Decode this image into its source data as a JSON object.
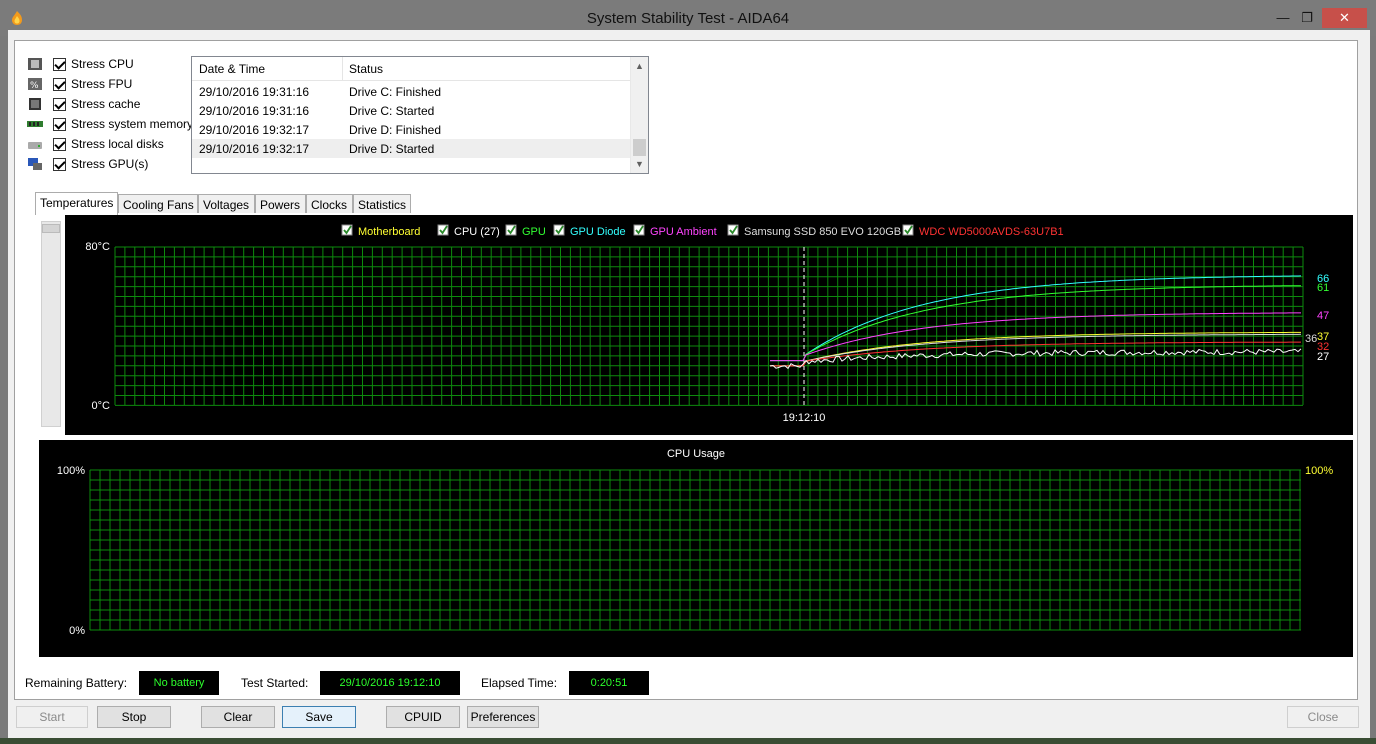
{
  "window": {
    "title": "System Stability Test - AIDA64",
    "minimize": "—",
    "restore": "❐",
    "close": "✕"
  },
  "stress": [
    {
      "icon": "cpu-icon",
      "label": "Stress CPU",
      "checked": true
    },
    {
      "icon": "fpu-icon",
      "label": "Stress FPU",
      "checked": true
    },
    {
      "icon": "cache-icon",
      "label": "Stress cache",
      "checked": true
    },
    {
      "icon": "memory-icon",
      "label": "Stress system memory",
      "checked": true
    },
    {
      "icon": "disk-icon",
      "label": "Stress local disks",
      "checked": true
    },
    {
      "icon": "gpu-icon",
      "label": "Stress GPU(s)",
      "checked": true
    }
  ],
  "log": {
    "headers": [
      "Date & Time",
      "Status"
    ],
    "rows": [
      {
        "time": "29/10/2016 19:31:16",
        "status": "Drive C: Finished"
      },
      {
        "time": "29/10/2016 19:31:16",
        "status": "Drive C: Started"
      },
      {
        "time": "29/10/2016 19:32:17",
        "status": "Drive D: Finished"
      },
      {
        "time": "29/10/2016 19:32:17",
        "status": "Drive D: Started"
      }
    ]
  },
  "tabs": [
    "Temperatures",
    "Cooling Fans",
    "Voltages",
    "Powers",
    "Clocks",
    "Statistics"
  ],
  "active_tab": "Temperatures",
  "chart_data": [
    {
      "type": "line",
      "title": "",
      "ylabel_top": "80°C",
      "ylabel_bottom": "0°C",
      "ylim": [
        0,
        80
      ],
      "x_marker_label": "19:12:10",
      "legend": [
        {
          "name": "Motherboard",
          "color": "#ffff33"
        },
        {
          "name": "CPU (27)",
          "color": "#ffffff"
        },
        {
          "name": "GPU",
          "color": "#33ff33"
        },
        {
          "name": "GPU Diode",
          "color": "#33ffff"
        },
        {
          "name": "GPU Ambient",
          "color": "#ff44ff"
        },
        {
          "name": "Samsung SSD 850 EVO 120GB",
          "color": "#dddddd"
        },
        {
          "name": "WDC WD5000AVDS-63U7B1",
          "color": "#ff3333"
        }
      ],
      "series": [
        {
          "name": "GPU Diode",
          "color": "#33ffff",
          "end_value": 66,
          "end_label": "66"
        },
        {
          "name": "GPU",
          "color": "#33ff33",
          "end_value": 61,
          "end_label": "61"
        },
        {
          "name": "GPU Ambient",
          "color": "#ff44ff",
          "end_value": 47,
          "end_label": "47"
        },
        {
          "name": "Motherboard",
          "color": "#ffff33",
          "end_value": 37,
          "end_label": "37"
        },
        {
          "name": "Samsung SSD 850 EVO 120GB",
          "color": "#dddddd",
          "end_value": 36,
          "end_label": "36"
        },
        {
          "name": "WDC WD5000AVDS-63U7B1",
          "color": "#ff3333",
          "end_value": 32,
          "end_label": "32"
        },
        {
          "name": "CPU (27)",
          "color": "#ffffff",
          "end_value": 27,
          "end_label": "27"
        }
      ]
    },
    {
      "type": "line",
      "title": "CPU Usage",
      "ylabel_top": "100%",
      "ylabel_bottom": "0%",
      "ylabel_right": "100%",
      "ylim": [
        0,
        100
      ]
    }
  ],
  "status": {
    "battery_label": "Remaining Battery:",
    "battery_value": "No battery",
    "started_label": "Test Started:",
    "started_value": "29/10/2016 19:12:10",
    "elapsed_label": "Elapsed Time:",
    "elapsed_value": "0:20:51"
  },
  "buttons": {
    "start": "Start",
    "stop": "Stop",
    "clear": "Clear",
    "save": "Save",
    "cpuid": "CPUID",
    "preferences": "Preferences",
    "close": "Close"
  }
}
